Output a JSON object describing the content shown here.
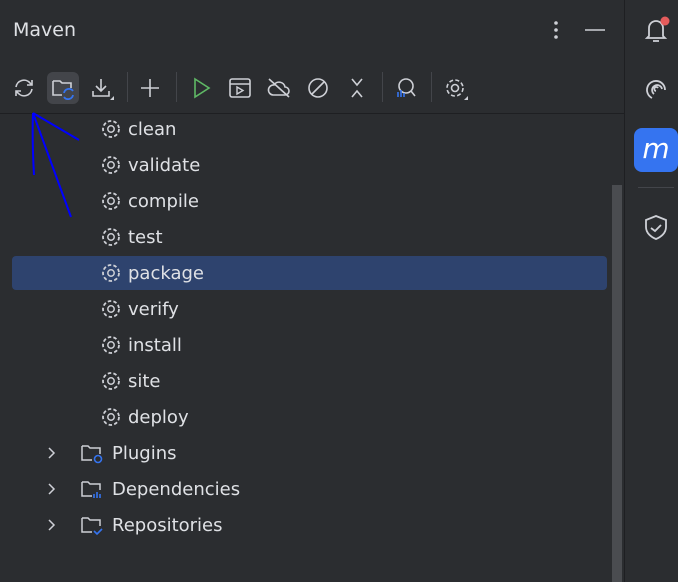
{
  "header": {
    "title": "Maven"
  },
  "toolbar": {
    "buttons": [
      "reload-all-projects",
      "generate-sources-and-update-folders",
      "download-sources",
      "add-maven-project",
      "run-maven-build",
      "execute-maven-goal",
      "toggle-offline-mode",
      "toggle-skip-tests",
      "collapse-all",
      "analyze-dependencies",
      "build-tool-settings"
    ]
  },
  "lifecycle": [
    {
      "label": "clean"
    },
    {
      "label": "validate"
    },
    {
      "label": "compile"
    },
    {
      "label": "test"
    },
    {
      "label": "package",
      "selected": true
    },
    {
      "label": "verify"
    },
    {
      "label": "install"
    },
    {
      "label": "site"
    },
    {
      "label": "deploy"
    }
  ],
  "groups": [
    {
      "label": "Plugins"
    },
    {
      "label": "Dependencies"
    },
    {
      "label": "Repositories"
    }
  ],
  "sidebar": {
    "maven_letter": "m"
  },
  "colors": {
    "accent": "#3574f0",
    "selected": "#2e436e",
    "run": "#5fb865",
    "annotation": "#0000ff",
    "badge": "#e55c5c"
  }
}
